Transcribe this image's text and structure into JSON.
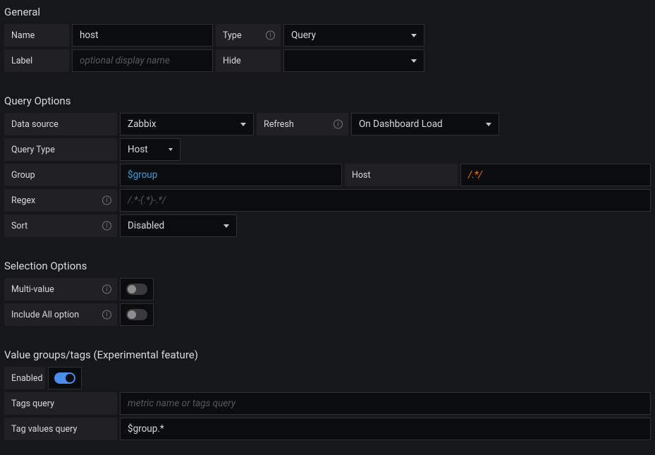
{
  "general": {
    "title": "General",
    "name_label": "Name",
    "name_value": "host",
    "type_label": "Type",
    "type_value": "Query",
    "label_label": "Label",
    "label_placeholder": "optional display name",
    "hide_label": "Hide",
    "hide_value": ""
  },
  "queryOptions": {
    "title": "Query Options",
    "datasource_label": "Data source",
    "datasource_value": "Zabbix",
    "refresh_label": "Refresh",
    "refresh_value": "On Dashboard Load",
    "querytype_label": "Query Type",
    "querytype_value": "Host",
    "group_label": "Group",
    "group_value": "$group",
    "host_label": "Host",
    "host_value": "/.*/",
    "regex_label": "Regex",
    "regex_placeholder": "/.*-(.*)-.*/",
    "sort_label": "Sort",
    "sort_value": "Disabled"
  },
  "selectionOptions": {
    "title": "Selection Options",
    "multivalue_label": "Multi-value",
    "includeall_label": "Include All option"
  },
  "valueGroups": {
    "title": "Value groups/tags (Experimental feature)",
    "enabled_label": "Enabled",
    "tagsquery_label": "Tags query",
    "tagsquery_placeholder": "metric name or tags query",
    "tagvalues_label": "Tag values query",
    "tagvalues_value": "$group.*"
  }
}
